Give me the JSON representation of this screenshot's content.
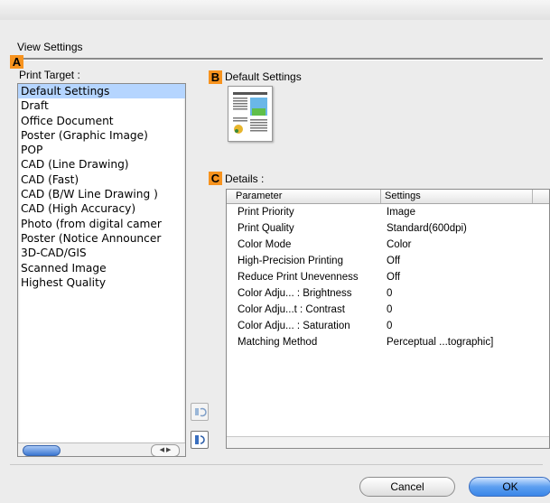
{
  "section_title": "View Settings",
  "markers": {
    "a": "A",
    "b": "B",
    "c": "C"
  },
  "print_target": {
    "label": "Print Target :",
    "items": [
      "Default Settings",
      "Draft",
      "Office Document",
      "Poster (Graphic Image)",
      "POP",
      "CAD (Line Drawing)",
      "CAD (Fast)",
      "CAD (B/W Line Drawing )",
      "CAD (High Accuracy)",
      "Photo (from digital camer",
      "Poster (Notice Announcer",
      "3D-CAD/GIS",
      "Scanned Image",
      "Highest Quality"
    ],
    "selected_index": 0
  },
  "default_settings": {
    "label": "Default Settings"
  },
  "details": {
    "label": "Details :",
    "headers": {
      "parameter": "Parameter",
      "settings": "Settings"
    },
    "rows": [
      {
        "parameter": "Print Priority",
        "setting": "Image"
      },
      {
        "parameter": "Print Quality",
        "setting": "Standard(600dpi)"
      },
      {
        "parameter": "Color Mode",
        "setting": "Color"
      },
      {
        "parameter": "High-Precision Printing",
        "setting": "Off"
      },
      {
        "parameter": "Reduce Print Unevenness",
        "setting": "Off"
      },
      {
        "parameter": "Color Adju... : Brightness",
        "setting": "0"
      },
      {
        "parameter": "Color Adju...t : Contrast",
        "setting": "0"
      },
      {
        "parameter": "Color Adju... : Saturation",
        "setting": "0"
      },
      {
        "parameter": "Matching Method",
        "setting": "Perceptual ...tographic]"
      }
    ]
  },
  "buttons": {
    "cancel": "Cancel",
    "ok": "OK"
  },
  "colors": {
    "marker": "#f7931e",
    "selection": "#b5d5ff",
    "ok_button": "#3a86e8"
  }
}
